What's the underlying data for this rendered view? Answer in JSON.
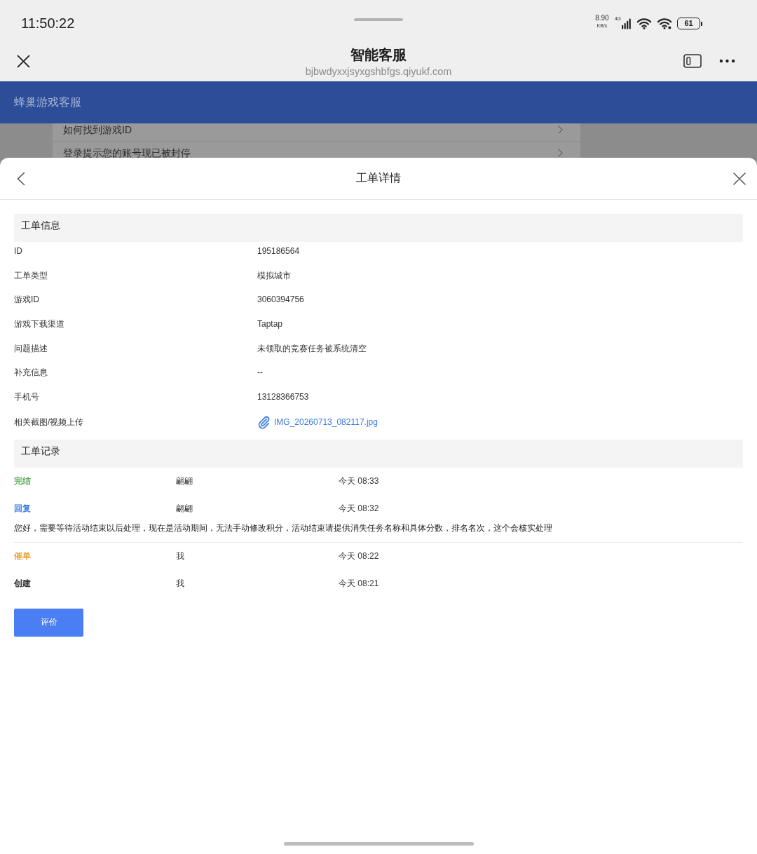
{
  "status_bar": {
    "time": "11:50:22",
    "net_speed": "8.90",
    "net_speed_unit": "KB/s",
    "network": "4G",
    "battery": "61"
  },
  "browser": {
    "title": "智能客服",
    "url": "bjbwdyxxjsyxgshbfgs.qiyukf.com"
  },
  "site_header": {
    "title": "蜂巢游戏客服"
  },
  "background_list": [
    {
      "label": "如何找到游戏ID"
    },
    {
      "label": "登录提示您的账号现已被封停"
    }
  ],
  "sheet": {
    "title": "工单详情"
  },
  "info_section": {
    "title": "工单信息",
    "fields": [
      {
        "kind": "text",
        "label": "ID",
        "value": "195186564"
      },
      {
        "kind": "text",
        "label": "工单类型",
        "value": "模拟城市"
      },
      {
        "kind": "text",
        "label": "游戏ID",
        "value": "3060394756"
      },
      {
        "kind": "text",
        "label": "游戏下载渠道",
        "value": "Taptap"
      },
      {
        "kind": "text",
        "label": "问题描述",
        "value": "未领取的竞赛任务被系统清空"
      },
      {
        "kind": "text",
        "label": "补充信息",
        "value": "--"
      },
      {
        "kind": "text",
        "label": "手机号",
        "value": "13128366753"
      },
      {
        "kind": "attachment",
        "label": "相关截图/视频上传",
        "value": "IMG_20260713_082117.jpg"
      }
    ]
  },
  "record_section": {
    "title": "工单记录",
    "entries": [
      {
        "status": "完结",
        "color": "#5fab5a",
        "actor": "翩翩",
        "time": "今天 08:33"
      },
      {
        "status": "回复",
        "color": "#3b7be3",
        "actor": "翩翩",
        "time": "今天 08:32",
        "message": "您好，需要等待活动结束以后处理，现在是活动期间，无法手动修改积分，活动结束请提供消失任务名称和具体分数，排名名次，这个会核实处理"
      },
      {
        "status": "催单",
        "color": "#f0a23c",
        "actor": "我",
        "time": "今天 08:22"
      },
      {
        "status": "创建",
        "color": "#333333",
        "actor": "我",
        "time": "今天 08:21"
      }
    ]
  },
  "rate_button": {
    "label": "评价"
  }
}
